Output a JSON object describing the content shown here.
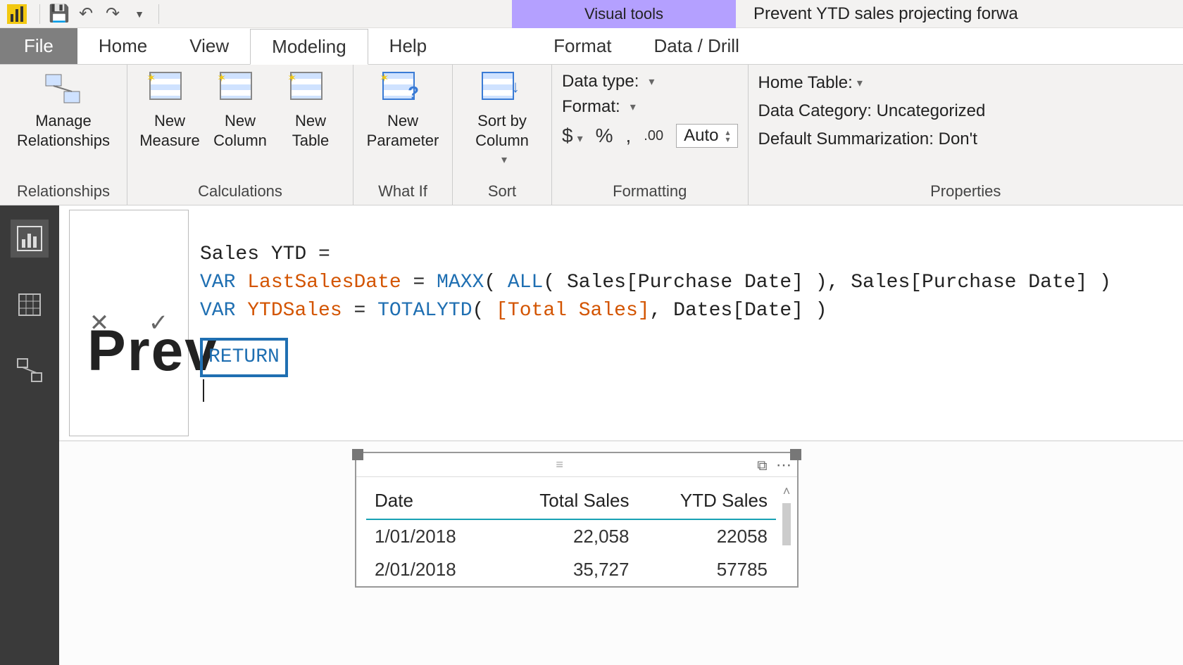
{
  "title_bar": {
    "context_tab": "Visual tools",
    "document_title": "Prevent YTD sales projecting forwa"
  },
  "tabs": {
    "file": "File",
    "home": "Home",
    "view": "View",
    "modeling": "Modeling",
    "help": "Help",
    "format": "Format",
    "data_drill": "Data / Drill"
  },
  "ribbon": {
    "relationships": {
      "manage": "Manage\nRelationships",
      "group": "Relationships"
    },
    "calculations": {
      "new_measure": "New\nMeasure",
      "new_column": "New\nColumn",
      "new_table": "New\nTable",
      "group": "Calculations"
    },
    "whatif": {
      "new_parameter": "New\nParameter",
      "group": "What If"
    },
    "sort": {
      "sort_by_column": "Sort by\nColumn",
      "group": "Sort"
    },
    "formatting": {
      "data_type": "Data type:",
      "format": "Format:",
      "auto": "Auto",
      "group": "Formatting"
    },
    "properties": {
      "home_table": "Home Table:",
      "data_category": "Data Category: Uncategorized",
      "default_sum": "Default Summarization: Don't",
      "group": "Properties"
    }
  },
  "formula": {
    "line1_a": "Sales YTD = ",
    "var": "VAR",
    "last_sales_var": "LastSalesDate",
    "eq": " = ",
    "maxx": "MAXX",
    "all": "ALL",
    "sales_pd": "Sales[Purchase Date]",
    "ytd_var": "YTDSales",
    "totalytd": "TOTALYTD",
    "total_sales_m": "[Total Sales]",
    "dates_date": "Dates[Date]",
    "return": "RETURN"
  },
  "watermark": "Prev",
  "table": {
    "columns": {
      "date": "Date",
      "total_sales": "Total Sales",
      "ytd_sales": "YTD Sales"
    },
    "rows": [
      {
        "date": "1/01/2018",
        "total_sales": "22,058",
        "ytd_sales": "22058"
      },
      {
        "date": "2/01/2018",
        "total_sales": "35,727",
        "ytd_sales": "57785"
      }
    ]
  },
  "chart_data": {
    "type": "table",
    "columns": [
      "Date",
      "Total Sales",
      "YTD Sales"
    ],
    "rows": [
      [
        "1/01/2018",
        22058,
        22058
      ],
      [
        "2/01/2018",
        35727,
        57785
      ]
    ]
  }
}
